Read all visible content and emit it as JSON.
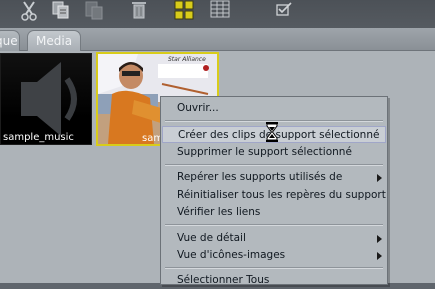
{
  "toolbar": {
    "icons": [
      "scissors-icon",
      "copy-icon",
      "paste-icon",
      "trash-icon",
      "thumbnail-view-icon",
      "grid-view-icon",
      "check-icon"
    ]
  },
  "tabs": [
    {
      "label": "que",
      "active": false
    },
    {
      "label": "Media",
      "active": true
    }
  ],
  "media": [
    {
      "name": "sample_music",
      "kind": "audio"
    },
    {
      "name": "sam",
      "kind": "video"
    }
  ],
  "photo_caption": "Star Alliance",
  "context_menu": {
    "items": [
      {
        "label": "Ouvrir...",
        "submenu": false
      },
      {
        "label": "Créer des clips de support sélectionné",
        "submenu": false,
        "highlighted": true
      },
      {
        "label": "Supprimer le support sélectionné",
        "submenu": false
      },
      {
        "label": "Repérer les supports utilisés de",
        "submenu": true
      },
      {
        "label": "Réinitialiser tous les repères du support",
        "submenu": false
      },
      {
        "label": "Vérifier les liens",
        "submenu": false
      },
      {
        "label": "Vue de détail",
        "submenu": true
      },
      {
        "label": "Vue d'icônes-images",
        "submenu": true
      },
      {
        "label": "Sélectionner Tous",
        "submenu": false
      }
    ]
  },
  "colors": {
    "toolbar": "#52575d",
    "tabbar": "#969ca2",
    "content": "#adb3b8",
    "menu": "#b3b9be",
    "highlight": "#c9ced4",
    "accent_yellow": "#d8cc1a"
  }
}
